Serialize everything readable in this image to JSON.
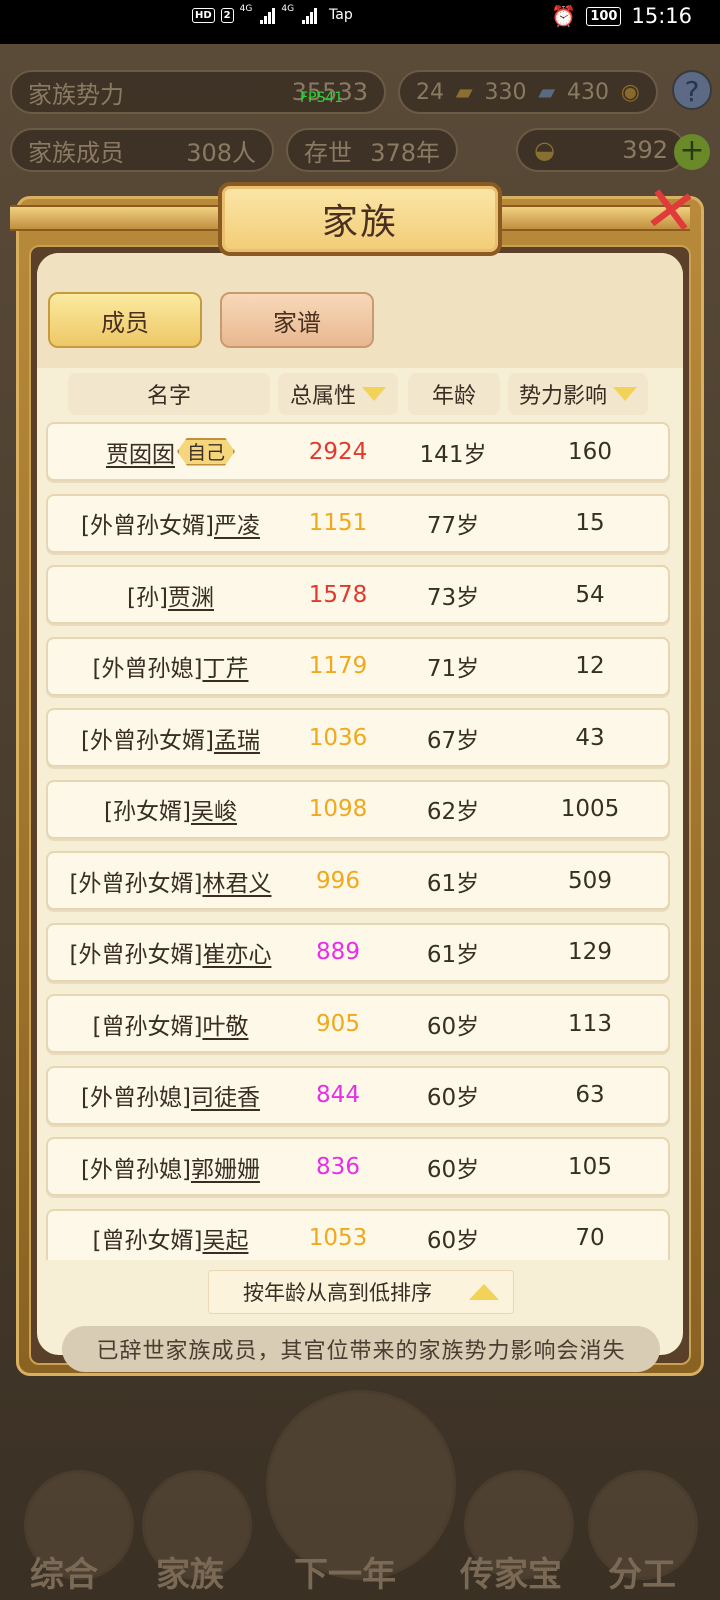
{
  "status_bar": {
    "hd": "HD",
    "sim": "2",
    "net1": "4G",
    "net2": "4G",
    "carrier_app": "Tap",
    "battery": "100",
    "time": "15:16"
  },
  "hud": {
    "family_power_label": "家族势力",
    "family_power_value": "35533",
    "fps": "FPS41",
    "res1": "24",
    "res2": "330",
    "res3": "430",
    "members_label": "家族成员",
    "members_value": "308人",
    "exist_label": "存世",
    "exist_value": "378年",
    "gold": "392",
    "help": "?"
  },
  "modal": {
    "title": "家族",
    "tabs": [
      "成员",
      "家谱"
    ],
    "headers": {
      "name": "名字",
      "attr": "总属性",
      "age": "年龄",
      "influence": "势力影响"
    },
    "self_badge": "自己",
    "rows": [
      {
        "prefix": "",
        "name": "贾囡囡",
        "self": true,
        "attr": "2924",
        "attr_color": "#e03a2e",
        "age": "141岁",
        "influence": "160"
      },
      {
        "prefix": "[外曾孙女婿]",
        "name": "严凌",
        "self": false,
        "attr": "1151",
        "attr_color": "#f0a81c",
        "age": "77岁",
        "influence": "15"
      },
      {
        "prefix": "[孙]",
        "name": "贾渊",
        "self": false,
        "attr": "1578",
        "attr_color": "#e03a2e",
        "age": "73岁",
        "influence": "54"
      },
      {
        "prefix": "[外曾孙媳]",
        "name": "丁芹",
        "self": false,
        "attr": "1179",
        "attr_color": "#f0a81c",
        "age": "71岁",
        "influence": "12"
      },
      {
        "prefix": "[外曾孙女婿]",
        "name": "孟瑞",
        "self": false,
        "attr": "1036",
        "attr_color": "#f0a81c",
        "age": "67岁",
        "influence": "43"
      },
      {
        "prefix": "[孙女婿]",
        "name": "吴峻",
        "self": false,
        "attr": "1098",
        "attr_color": "#f0a81c",
        "age": "62岁",
        "influence": "1005"
      },
      {
        "prefix": "[外曾孙女婿]",
        "name": "林君义",
        "self": false,
        "attr": "996",
        "attr_color": "#f0a81c",
        "age": "61岁",
        "influence": "509"
      },
      {
        "prefix": "[外曾孙女婿]",
        "name": "崔亦心",
        "self": false,
        "attr": "889",
        "attr_color": "#e82ee8",
        "age": "61岁",
        "influence": "129"
      },
      {
        "prefix": "[曾孙女婿]",
        "name": "叶敬",
        "self": false,
        "attr": "905",
        "attr_color": "#f0a81c",
        "age": "60岁",
        "influence": "113"
      },
      {
        "prefix": "[外曾孙媳]",
        "name": "司徒香",
        "self": false,
        "attr": "844",
        "attr_color": "#e82ee8",
        "age": "60岁",
        "influence": "63"
      },
      {
        "prefix": "[外曾孙媳]",
        "name": "郭姗姗",
        "self": false,
        "attr": "836",
        "attr_color": "#e82ee8",
        "age": "60岁",
        "influence": "105"
      },
      {
        "prefix": "[曾孙女婿]",
        "name": "吴起",
        "self": false,
        "attr": "1053",
        "attr_color": "#f0a81c",
        "age": "60岁",
        "influence": "70"
      }
    ],
    "sort_label": "按年龄从高到低排序",
    "notice": "已辞世家族成员，其官位带来的家族势力影响会消失"
  },
  "bottom_nav": [
    "综合",
    "家族",
    "下一年",
    "传家宝",
    "分工"
  ]
}
